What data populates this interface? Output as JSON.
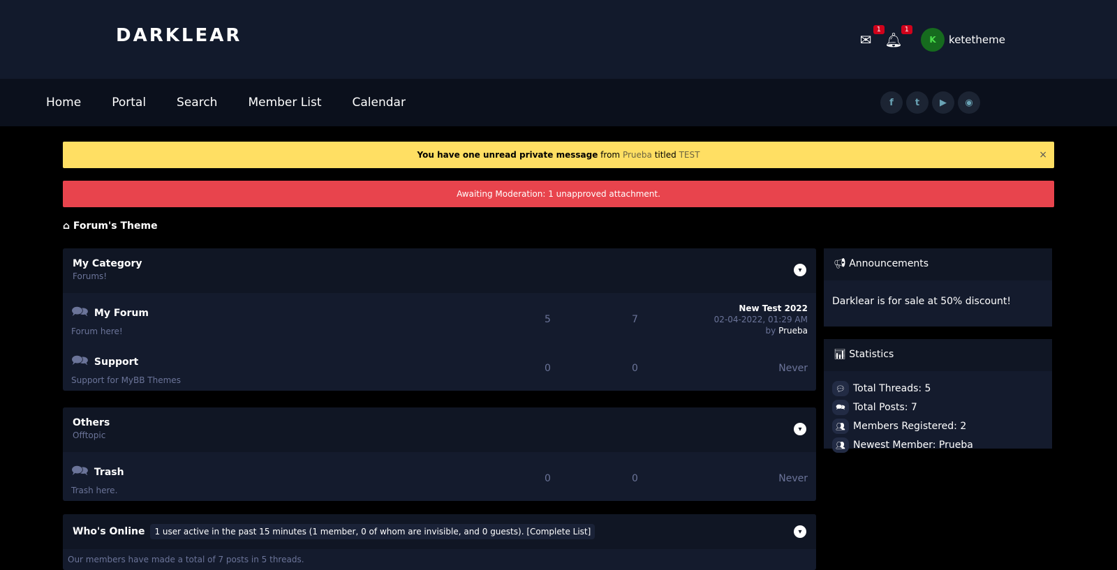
{
  "header": {
    "logo": "DARKLEAR",
    "messages_count": "1",
    "notifications_count": "1",
    "avatar_letter": "K",
    "username": "ketetheme"
  },
  "nav": [
    "Home",
    "Portal",
    "Search",
    "Member List",
    "Calendar"
  ],
  "social": [
    "facebook",
    "twitter",
    "youtube",
    "discord"
  ],
  "pm_alert": {
    "prefix": "You have one unread private message",
    "from_label": "from",
    "from": "Prueba",
    "titled_label": "titled",
    "title": "TEST",
    "close": "×"
  },
  "mod_alert": "Awaiting Moderation: 1 unapproved attachment.",
  "breadcrumb": "Forum's Theme",
  "categories": [
    {
      "title": "My Category",
      "desc": "Forums!",
      "forums": [
        {
          "name": "My Forum",
          "desc": "Forum here!",
          "threads": "5",
          "posts": "7",
          "last_title": "New Test 2022",
          "last_date": "02-04-2022, 01:29 AM",
          "by": "by",
          "last_user": "Prueba"
        },
        {
          "name": "Support",
          "desc": "Support for MyBB Themes",
          "threads": "0",
          "posts": "0",
          "last": "Never"
        }
      ]
    },
    {
      "title": "Others",
      "desc": "Offtopic",
      "forums": [
        {
          "name": "Trash",
          "desc": "Trash here.",
          "threads": "0",
          "posts": "0",
          "last": "Never"
        }
      ]
    }
  ],
  "whos_online": {
    "title": "Who's Online",
    "summary": "1 user active in the past 15 minutes (1 member, 0 of whom are invisible, and 0 guests). [Complete List]",
    "stats": "Our members have made a total of 7 posts in 5 threads."
  },
  "announcements": {
    "title": "Announcements",
    "text": "Darklear is for sale at 50% discount!"
  },
  "statistics": {
    "title": "Statistics",
    "items": [
      "Total Threads: 5",
      "Total Posts: 7",
      "Members Registered: 2",
      "Newest Member: Prueba"
    ]
  }
}
